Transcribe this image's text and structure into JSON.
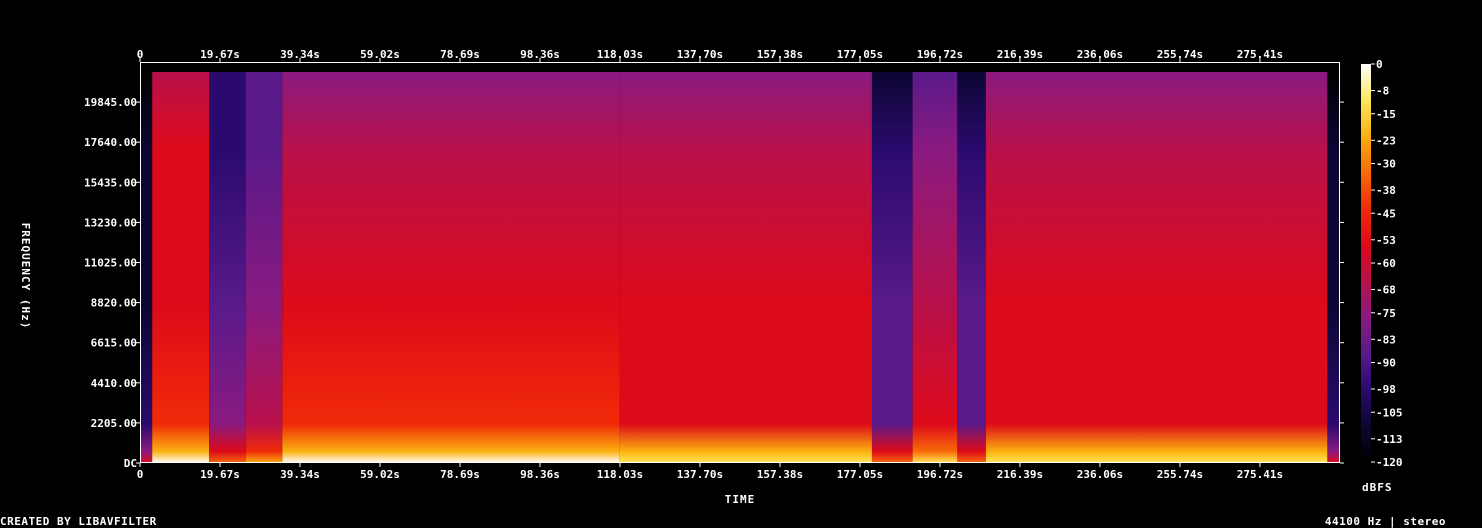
{
  "chart_data": {
    "type": "heatmap",
    "title": "",
    "xlabel": "TIME",
    "ylabel": "FREQUENCY (Hz)",
    "colorbar_label": "dBFS",
    "x_ticks": [
      "0",
      "19.67s",
      "39.34s",
      "59.02s",
      "78.69s",
      "98.36s",
      "118.03s",
      "137.70s",
      "157.38s",
      "177.05s",
      "196.72s",
      "216.39s",
      "236.06s",
      "255.74s",
      "275.41s"
    ],
    "x_tick_values": [
      0,
      19.67,
      39.34,
      59.02,
      78.69,
      98.36,
      118.03,
      137.7,
      157.38,
      177.05,
      196.72,
      216.39,
      236.06,
      255.74,
      275.41
    ],
    "xlim": [
      0,
      295.1
    ],
    "y_ticks": [
      "DC",
      "2205.00",
      "4410.00",
      "6615.00",
      "8820.00",
      "11025.00",
      "13230.00",
      "15435.00",
      "17640.00",
      "19845.00"
    ],
    "y_tick_values": [
      0,
      2205,
      4410,
      6615,
      8820,
      11025,
      13230,
      15435,
      17640,
      19845
    ],
    "ylim": [
      0,
      22050
    ],
    "colorbar_ticks": [
      "0",
      "-8",
      "-15",
      "-23",
      "-30",
      "-38",
      "-45",
      "-53",
      "-60",
      "-68",
      "-75",
      "-83",
      "-90",
      "-98",
      "-105",
      "-113",
      "-120"
    ],
    "colorbar_values": [
      0,
      -8,
      -15,
      -23,
      -30,
      -38,
      -45,
      -53,
      -60,
      -68,
      -75,
      -83,
      -90,
      -98,
      -105,
      -113,
      -120
    ],
    "colorbar_range": [
      -120,
      0
    ],
    "colormap": [
      "#000000",
      "#0d0633",
      "#2a0a6e",
      "#5a1a8a",
      "#8a1a80",
      "#b8104a",
      "#dd0a1a",
      "#f02a08",
      "#f86a08",
      "#fbb010",
      "#fde85a",
      "#ffffff"
    ],
    "segments": [
      {
        "t_start": 0,
        "t_end": 3,
        "level": -110
      },
      {
        "t_start": 3,
        "t_end": 17,
        "level": -55
      },
      {
        "t_start": 17,
        "t_end": 26,
        "level": -92
      },
      {
        "t_start": 26,
        "t_end": 35,
        "level": -82
      },
      {
        "t_start": 35,
        "t_end": 118,
        "level": -62
      },
      {
        "t_start": 118,
        "t_end": 180,
        "level": -64
      },
      {
        "t_start": 180,
        "t_end": 190,
        "level": -96
      },
      {
        "t_start": 190,
        "t_end": 201,
        "level": -74
      },
      {
        "t_start": 201,
        "t_end": 208,
        "level": -96
      },
      {
        "t_start": 208,
        "t_end": 292,
        "level": -64
      },
      {
        "t_start": 292,
        "t_end": 295.1,
        "level": -110
      }
    ],
    "content_max_freq": 21500
  },
  "footer": {
    "left": "CREATED BY LIBAVFILTER",
    "right": "44100 Hz | stereo"
  }
}
